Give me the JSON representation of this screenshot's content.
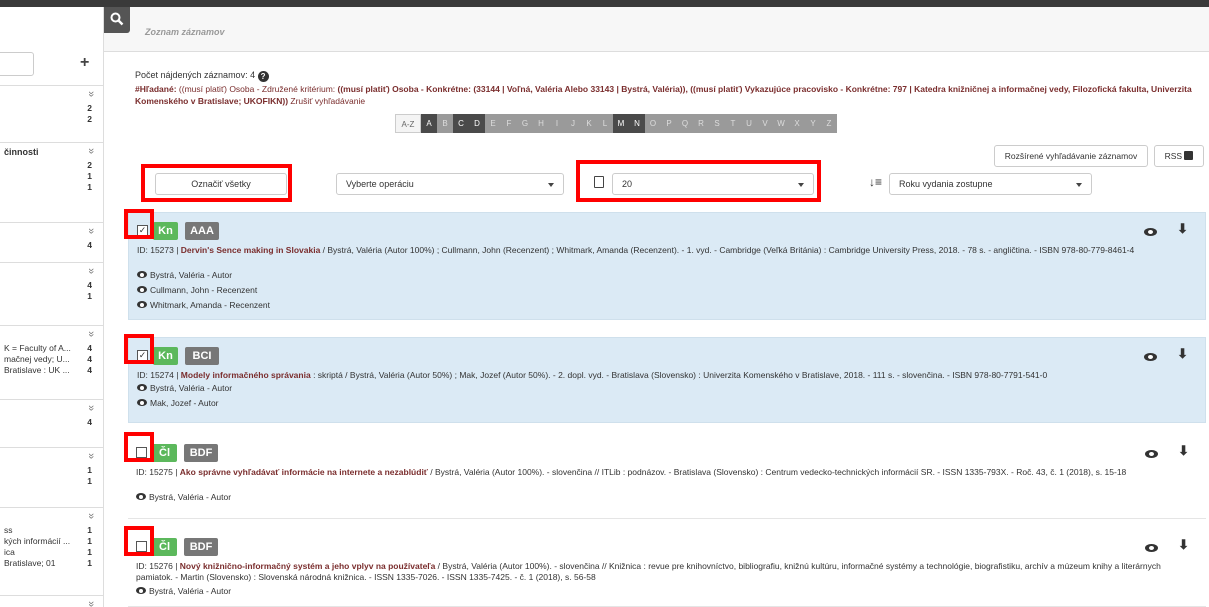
{
  "header": {
    "title": "Zoznam záznamov"
  },
  "sidebar": {
    "sections": [
      {
        "label": "",
        "rows": [
          {
            "t": "",
            "n": "2"
          },
          {
            "t": "",
            "n": "2"
          }
        ]
      },
      {
        "label": "činnosti",
        "rows": [
          {
            "t": "",
            "n": "2"
          },
          {
            "t": "",
            "n": "1"
          },
          {
            "t": "",
            "n": "1"
          }
        ]
      },
      {
        "label": "",
        "rows": [
          {
            "t": "",
            "n": "4"
          }
        ]
      },
      {
        "label": "",
        "rows": [
          {
            "t": "",
            "n": "4"
          },
          {
            "t": "",
            "n": "1"
          }
        ]
      },
      {
        "label": "",
        "rows": [
          {
            "t": "K = Faculty of A...",
            "n": "4"
          },
          {
            "t": "mačnej vedy; U...",
            "n": "4"
          },
          {
            "t": "Bratislave : UK ...",
            "n": "4"
          }
        ]
      },
      {
        "label": "",
        "rows": [
          {
            "t": "",
            "n": "4"
          }
        ]
      },
      {
        "label": "",
        "rows": [
          {
            "t": "",
            "n": "1"
          },
          {
            "t": "",
            "n": "1"
          }
        ]
      },
      {
        "label": "",
        "rows": [
          {
            "t": "ss",
            "n": "1"
          },
          {
            "t": "kých informácií ...",
            "n": "1"
          },
          {
            "t": "ica",
            "n": "1"
          },
          {
            "t": "Bratislave; 01",
            "n": "1"
          }
        ]
      },
      {
        "label": "",
        "rows": []
      }
    ]
  },
  "results": {
    "count_label": "Počet nájdených záznamov: 4",
    "query_label": "#Hľadané:",
    "query_plain1": " ((musí platiť) Osoba - Združené kritérium: ",
    "query_bold1": "((musí platiť) Osoba - Konkrétne: (33144 | Voľná, Valéria Alebo 33143 | Bystrá, Valéria)), ((musí platiť) Vykazujúce pracovisko - Konkrétne: 797 | Katedra knižničnej a informačnej vedy, Filozofická fakulta, Univerzita Komenského v Bratislave; UKOFIKN))",
    "cancel_search": " Zrušiť vyhľadávanie"
  },
  "alphabet": [
    "A-Z",
    "A",
    "B",
    "C",
    "D",
    "E",
    "F",
    "G",
    "H",
    "I",
    "J",
    "K",
    "L",
    "M",
    "N",
    "O",
    "P",
    "Q",
    "R",
    "S",
    "T",
    "U",
    "V",
    "W",
    "X",
    "Y",
    "Z"
  ],
  "alphabet_active": [
    "A",
    "C",
    "D",
    "M",
    "N"
  ],
  "toolbar": {
    "advanced_search": "Rozšírené vyhľadávanie záznamov",
    "rss": "RSS",
    "mark_all": "Označiť všetky",
    "operation_select": "Vyberte operáciu",
    "page_size": "20",
    "sort": "Roku vydania zostupne"
  },
  "records": [
    {
      "checked": true,
      "type": "Kn",
      "category": "AAA",
      "id": "ID: 15273 | ",
      "title": "Dervin's Sence making in Slovakia",
      "rest": " / Bystrá, Valéria (Autor 100%) ; Cullmann, John (Recenzent) ; Whitmark, Amanda (Recenzent). - 1. vyd. - Cambridge (Veľká Británia) : Cambridge University Press, 2018. - 78 s. - angličtina. - ISBN 978-80-779-8461-4",
      "persons": [
        "Bystrá, Valéria - Autor",
        "Cullmann, John - Recenzent",
        "Whitmark, Amanda - Recenzent"
      ]
    },
    {
      "checked": true,
      "type": "Kn",
      "category": "BCI",
      "id": "ID: 15274 | ",
      "title": "Modely informačného správania",
      "rest": " : skriptá / Bystrá, Valéria (Autor 50%) ; Mak, Jozef (Autor 50%). - 2. dopl. vyd. - Bratislava (Slovensko) : Univerzita Komenského v Bratislave, 2018. - 111 s. - slovenčina. - ISBN 978-80-7791-541-0",
      "persons": [
        "Bystrá, Valéria - Autor",
        "Mak, Jozef - Autor"
      ]
    },
    {
      "checked": false,
      "type": "Čl",
      "category": "BDF",
      "id": "ID: 15275 | ",
      "title": "Ako správne vyhľadávať informácie na internete a nezablúdiť",
      "rest": " / Bystrá, Valéria (Autor 100%). - slovenčina // ITLib : podnázov. - Bratislava (Slovensko) : Centrum vedecko-technických informácií SR. - ISSN 1335-793X. - Roč. 43, č. 1 (2018), s. 15-18",
      "persons": [
        "Bystrá, Valéria - Autor"
      ]
    },
    {
      "checked": false,
      "type": "Čl",
      "category": "BDF",
      "id": "ID: 15276 | ",
      "title": "Nový knižnično-informačný systém a jeho vplyv na používateľa",
      "rest": " / Bystrá, Valéria (Autor 100%). - slovenčina // Knižnica : revue pre knihovníctvo, bibliografiu, knižnú kultúru, informačné systémy a technológie, biografistiku, archív a múzeum knihy a literárnych pamiatok. - Martin (Slovensko) : Slovenská národná knižnica. - ISSN 1335-7026. - ISSN 1335-7425. - č. 1 (2018), s. 56-58",
      "persons": [
        "Bystrá, Valéria - Autor"
      ]
    }
  ]
}
